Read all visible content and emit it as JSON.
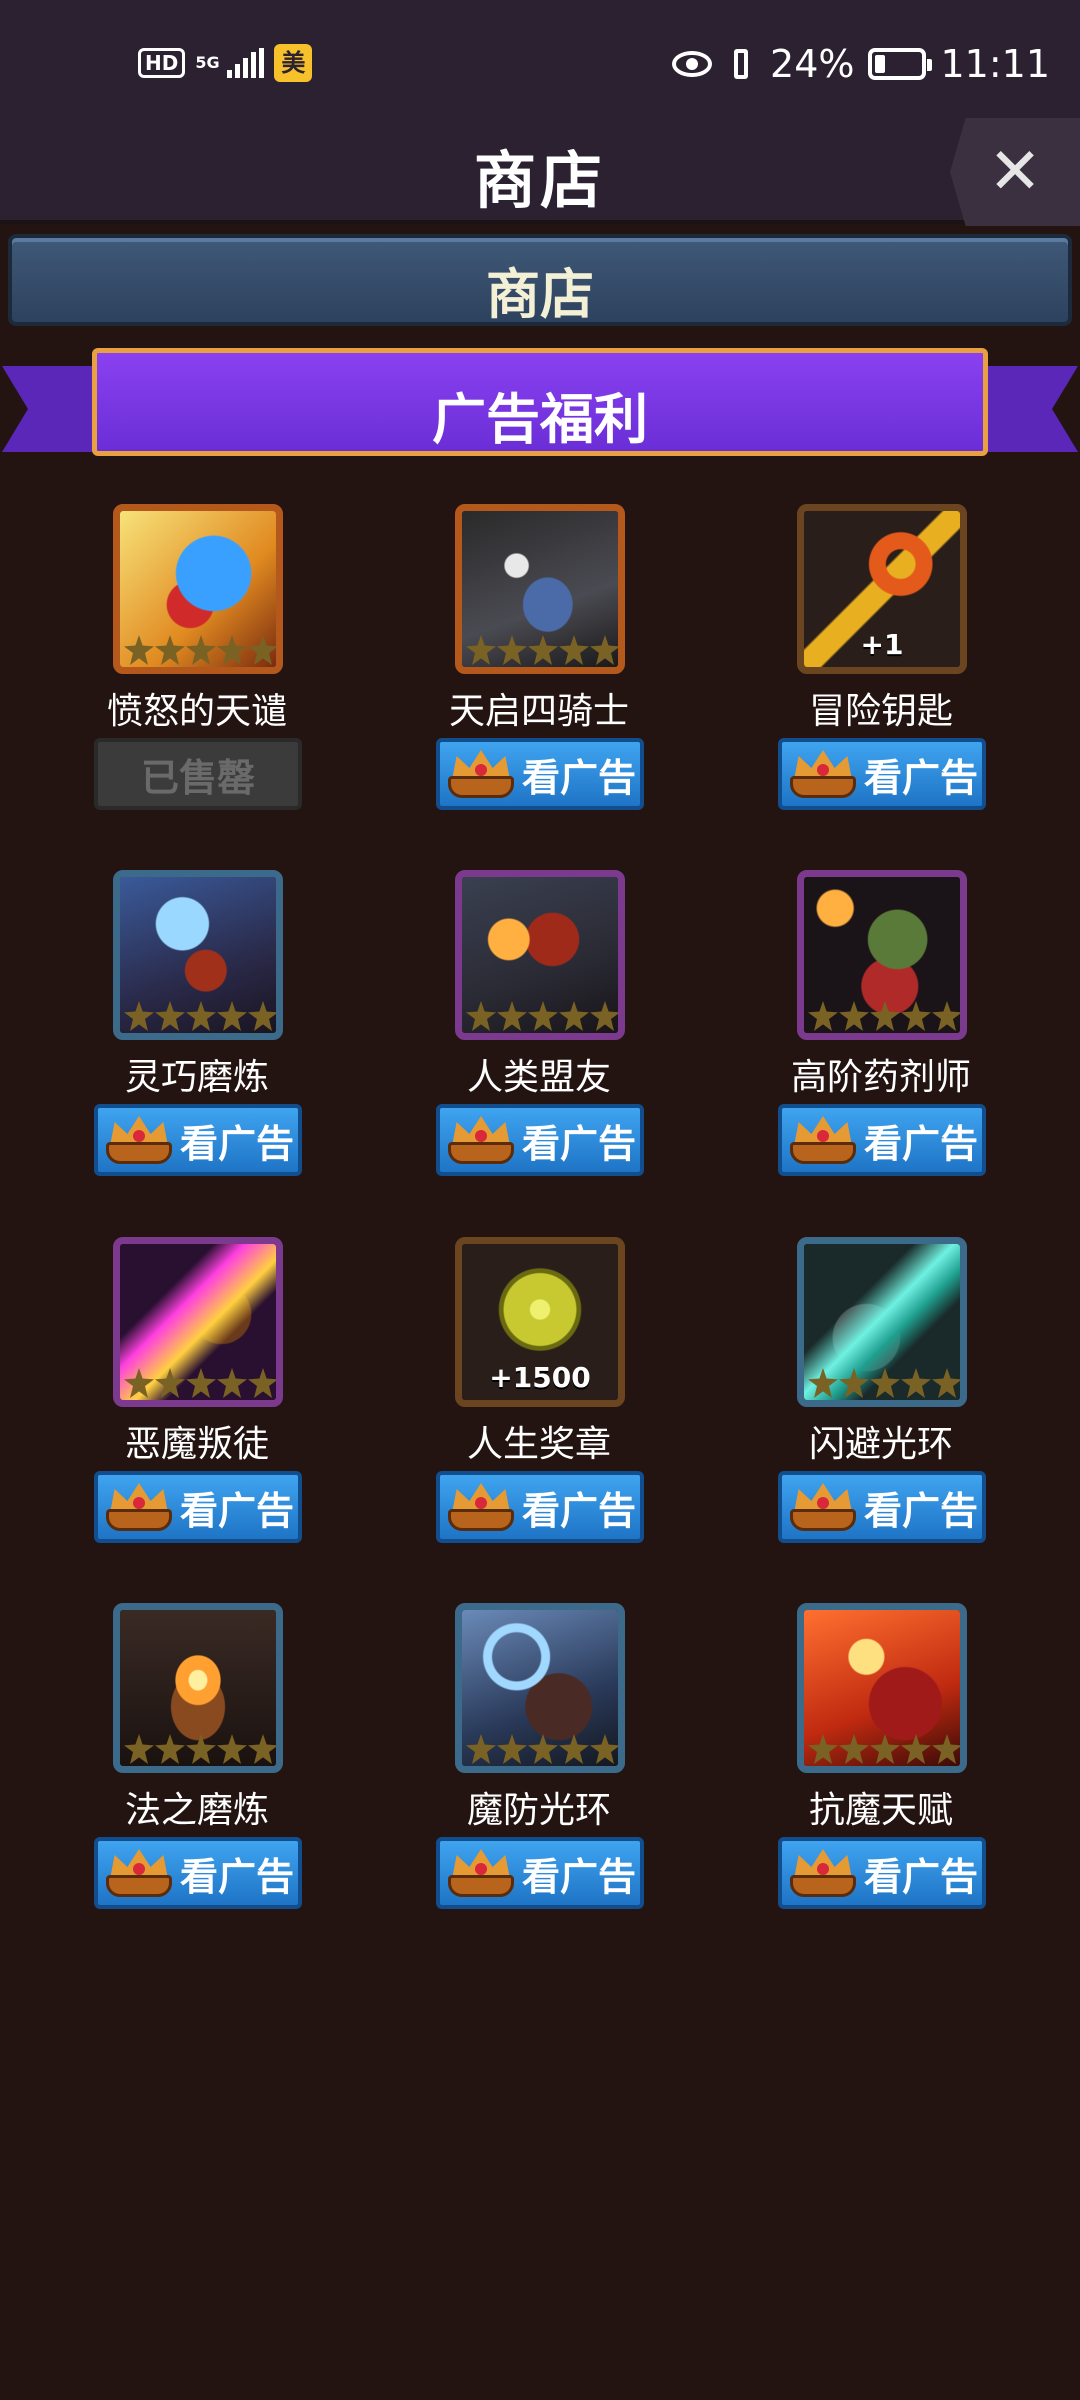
{
  "status_bar": {
    "hd": "HD",
    "network": "5G",
    "badge": "美",
    "battery": "24%",
    "time": "11:11"
  },
  "header": {
    "title": "商店",
    "close": "✕"
  },
  "shop_banner": {
    "label": "商店"
  },
  "ribbon": {
    "label": "广告福利"
  },
  "items": [
    {
      "name": "愤怒的天谴",
      "action": "已售罄",
      "sold_out": true,
      "quantity": ""
    },
    {
      "name": "天启四骑士",
      "action": "看广告",
      "sold_out": false,
      "quantity": ""
    },
    {
      "name": "冒险钥匙",
      "action": "看广告",
      "sold_out": false,
      "quantity": "+1"
    },
    {
      "name": "灵巧磨炼",
      "action": "看广告",
      "sold_out": false,
      "quantity": ""
    },
    {
      "name": "人类盟友",
      "action": "看广告",
      "sold_out": false,
      "quantity": ""
    },
    {
      "name": "高阶药剂师",
      "action": "看广告",
      "sold_out": false,
      "quantity": ""
    },
    {
      "name": "恶魔叛徒",
      "action": "看广告",
      "sold_out": false,
      "quantity": ""
    },
    {
      "name": "人生奖章",
      "action": "看广告",
      "sold_out": false,
      "quantity": "+1500"
    },
    {
      "name": "闪避光环",
      "action": "看广告",
      "sold_out": false,
      "quantity": ""
    },
    {
      "name": "法之磨炼",
      "action": "看广告",
      "sold_out": false,
      "quantity": ""
    },
    {
      "name": "魔防光环",
      "action": "看广告",
      "sold_out": false,
      "quantity": ""
    },
    {
      "name": "抗魔天赋",
      "action": "看广告",
      "sold_out": false,
      "quantity": ""
    }
  ]
}
